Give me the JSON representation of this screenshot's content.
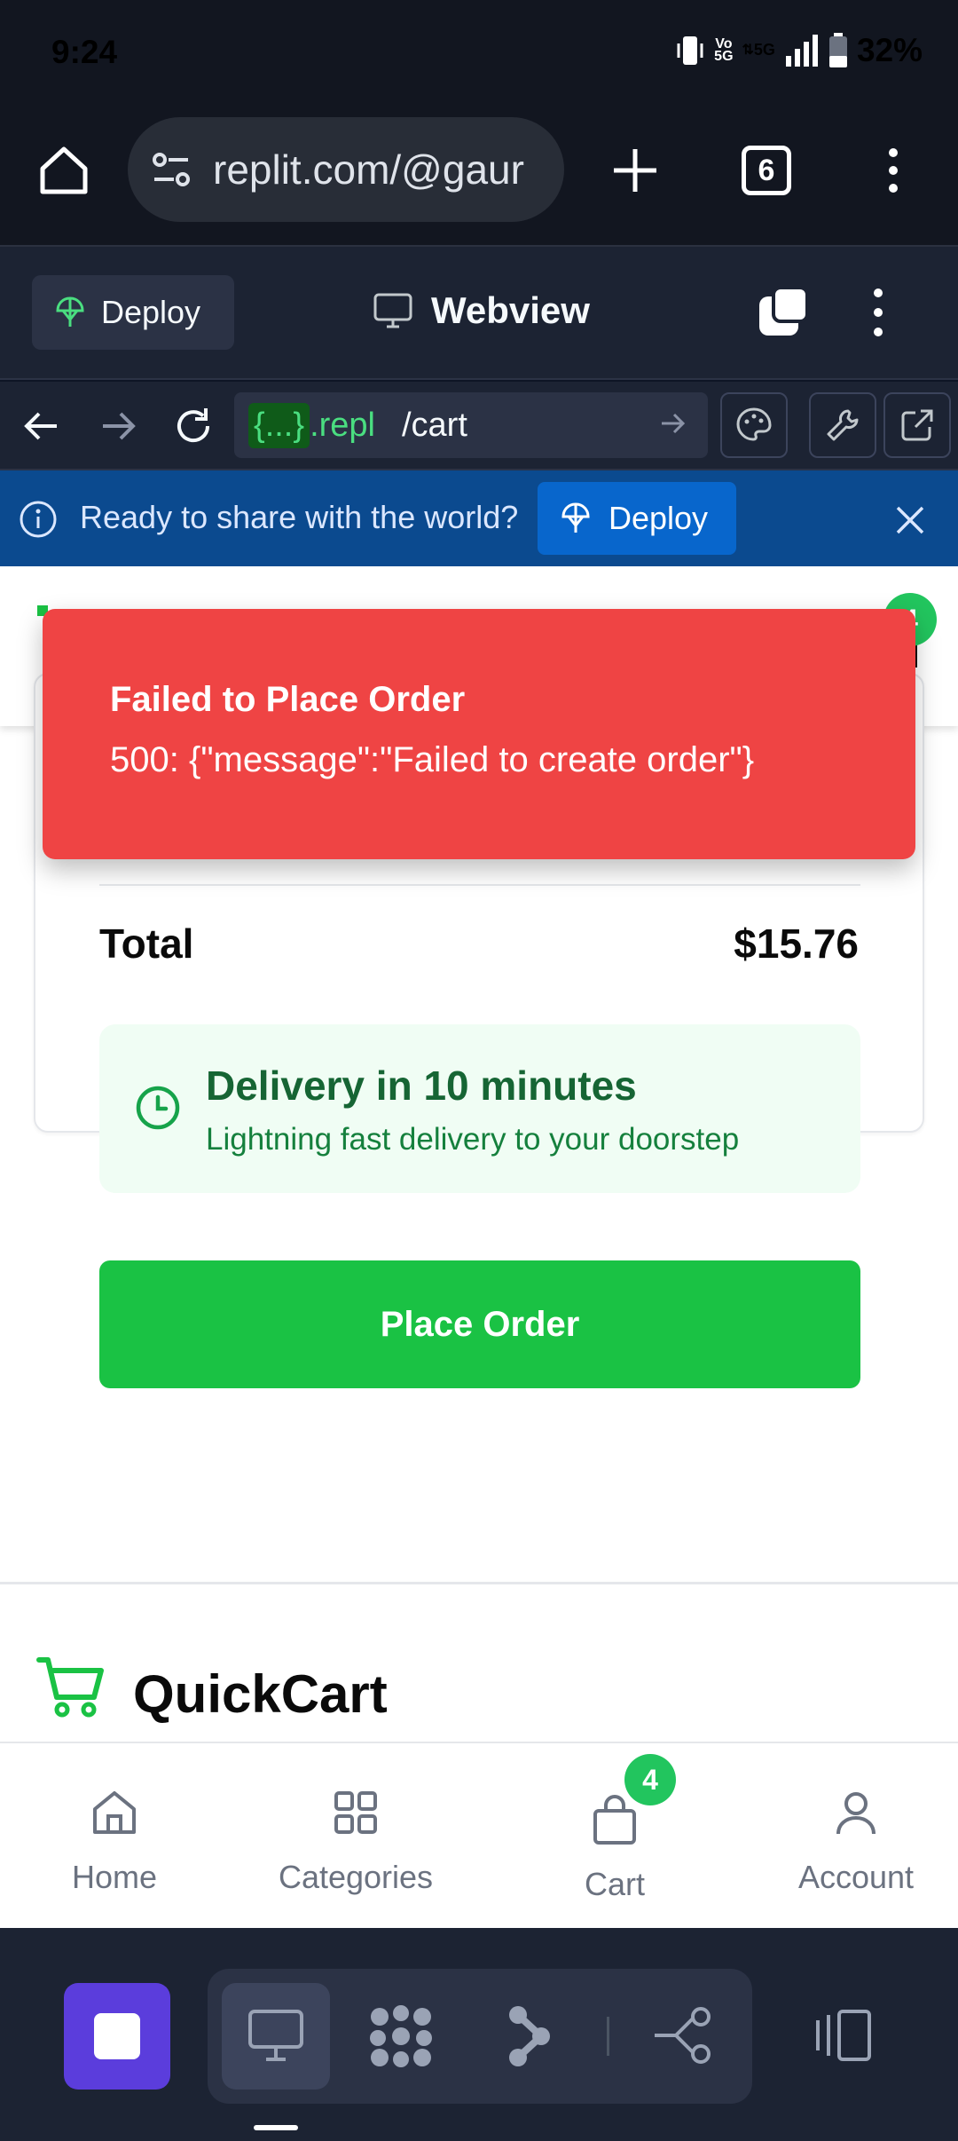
{
  "status_bar": {
    "time": "9:24",
    "network_top": "Vo",
    "network_bottom": "5G",
    "data_type": "5G",
    "battery": "32%"
  },
  "browser": {
    "url": "replit.com/@gaur",
    "tab_count": "6"
  },
  "replit": {
    "deploy_label": "Deploy",
    "webview_title": "Webview",
    "webview_host_chip": "{...}",
    "webview_host": ".repl",
    "webview_path": "/cart"
  },
  "banner": {
    "text": "Ready to share with the world?",
    "deploy_label": "Deploy"
  },
  "app": {
    "header_cart_badge": "4",
    "total_label": "Total",
    "total_value": "$15.76",
    "delivery_title": "Delivery in 10 minutes",
    "delivery_subtitle": "Lightning fast delivery to your doorstep",
    "place_order_label": "Place Order",
    "footer_brand": "QuickCart"
  },
  "toast": {
    "title": "Failed to Place Order",
    "message": "500: {\"message\":\"Failed to create order\"}"
  },
  "bottom_nav": {
    "items": [
      {
        "label": "Home",
        "icon": "home-icon"
      },
      {
        "label": "Categories",
        "icon": "grid-icon"
      },
      {
        "label": "Cart",
        "icon": "shopping-bag-icon",
        "badge": "4"
      },
      {
        "label": "Account",
        "icon": "user-icon"
      }
    ]
  },
  "colors": {
    "brand_green": "#1ac244",
    "toast_red": "#ef4444",
    "replit_dark": "#1c2333",
    "banner_blue": "#0b4a8f",
    "stop_purple": "#5b3ddc"
  }
}
